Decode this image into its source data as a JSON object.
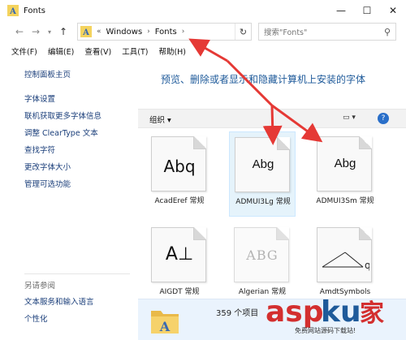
{
  "window": {
    "title": "Fonts",
    "controls": {
      "minimize": "—",
      "maximize": "☐",
      "close": "✕"
    }
  },
  "address": {
    "overflow": "«",
    "crumbs": [
      "Windows",
      "Fonts"
    ],
    "separator": "›",
    "refresh_icon": "refresh-icon",
    "search_placeholder": "搜索\"Fonts\""
  },
  "menu": [
    "文件(F)",
    "编辑(E)",
    "查看(V)",
    "工具(T)",
    "帮助(H)"
  ],
  "left_pane": {
    "home": "控制面板主页",
    "links": [
      "字体设置",
      "联机获取更多字体信息",
      "调整 ClearType 文本",
      "查找字符",
      "更改字体大小",
      "管理可选功能"
    ],
    "see_also_heading": "另请参阅",
    "see_also": [
      "文本服务和输入语言",
      "个性化"
    ]
  },
  "content": {
    "title": "预览、删除或者显示和隐藏计算机上安装的字体",
    "toolbar": {
      "organize": "组织 ▾",
      "view": "▭ ▾",
      "help": "?"
    },
    "fonts": [
      {
        "sample": "Abq",
        "label": "AcadEref 常规"
      },
      {
        "sample": "Abg",
        "label": "ADMUI3Lg 常规"
      },
      {
        "sample": "Abg",
        "label": "ADMUI3Sm 常规"
      },
      {
        "sample": "A⊥",
        "label": "AIGDT 常规"
      },
      {
        "sample": "ABG",
        "label": "Algerian 常规"
      },
      {
        "sample": "",
        "label": "AmdtSymbols"
      }
    ],
    "status": "359 个项目"
  },
  "watermark": {
    "text": "aspku家",
    "sub": "免费网站源码下载站!"
  },
  "colors": {
    "accent": "#1e5a9a",
    "arrow": "#e53935",
    "status_bg": "#eaf3fd"
  }
}
